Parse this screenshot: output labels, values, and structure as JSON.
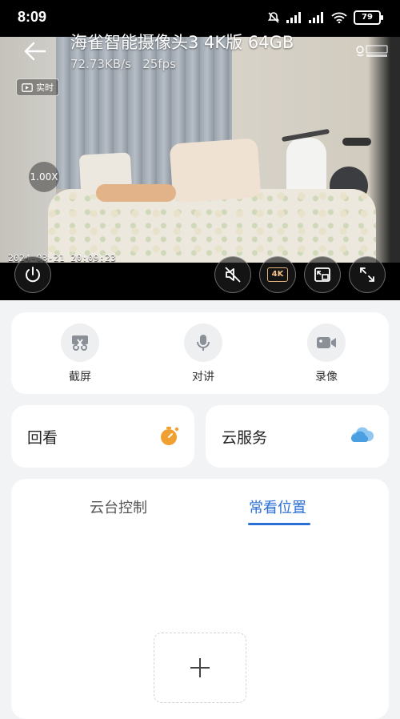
{
  "status_bar": {
    "time": "8:09",
    "battery": "79"
  },
  "camera": {
    "title": "海雀智能摄像头3 4K版 64GB",
    "rate_kbs": "72.73KB/s",
    "fps": "25fps",
    "live_label": "实时",
    "zoom": "1.00X",
    "timestamp": "2024-03-21  20:09:23",
    "quality": "4K",
    "brand": "海雀"
  },
  "actions": [
    {
      "label": "截屏",
      "icon": "scissors-icon"
    },
    {
      "label": "对讲",
      "icon": "microphone-icon"
    },
    {
      "label": "录像",
      "icon": "video-camera-icon"
    }
  ],
  "cards": {
    "playback": {
      "label": "回看",
      "icon": "timer-icon"
    },
    "cloud": {
      "label": "云服务",
      "icon": "cloud-icon"
    }
  },
  "tabs": [
    {
      "label": "云台控制",
      "active": false
    },
    {
      "label": "常看位置",
      "active": true
    }
  ],
  "colors": {
    "accent": "#2a6fd6",
    "timer": "#f0a030",
    "cloud": "#5aa9e6"
  }
}
